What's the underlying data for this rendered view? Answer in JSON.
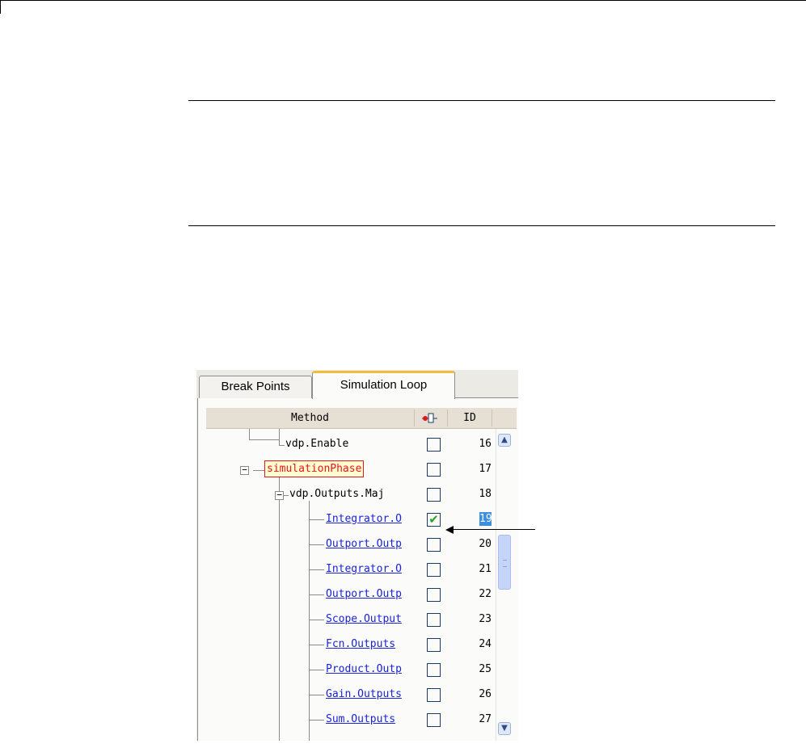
{
  "tabs": [
    {
      "label": "Break Points",
      "active": false
    },
    {
      "label": "Simulation Loop",
      "active": true
    }
  ],
  "table": {
    "method_header": "Method",
    "breakpoint_header_icon": "breakpoint-icon",
    "id_header": "ID"
  },
  "rows": [
    {
      "text": "vdp.Enable",
      "style": "plain",
      "id": "16",
      "checked": false
    },
    {
      "text": "simulationPhase",
      "style": "phase",
      "id": "17",
      "checked": false
    },
    {
      "text": "vdp.Outputs.Maj",
      "style": "plain",
      "id": "18",
      "checked": false
    },
    {
      "text": "Integrator.O",
      "style": "link",
      "id": "19",
      "checked": true,
      "selected": true
    },
    {
      "text": "Outport.Outp",
      "style": "link",
      "id": "20",
      "checked": false
    },
    {
      "text": "Integrator.O",
      "style": "link",
      "id": "21",
      "checked": false
    },
    {
      "text": "Outport.Outp",
      "style": "link",
      "id": "22",
      "checked": false
    },
    {
      "text": "Scope.Output",
      "style": "link",
      "id": "23",
      "checked": false
    },
    {
      "text": "Fcn.Outputs",
      "style": "link",
      "id": "24",
      "checked": false
    },
    {
      "text": "Product.Outp",
      "style": "link",
      "id": "25",
      "checked": false
    },
    {
      "text": "Gain.Outputs",
      "style": "link",
      "id": "26",
      "checked": false
    },
    {
      "text": "Sum.Outputs",
      "style": "link",
      "id": "27",
      "checked": false
    }
  ],
  "checkmark_glyph": "✔",
  "expander_glyph": "−",
  "scroll_up_glyph": "▲",
  "scroll_down_glyph": "▼",
  "colors": {
    "tab_accent": "#f4ba3c",
    "link": "#1a23d8",
    "phase_text": "#e8141e",
    "check": "#27a327",
    "selection": "#3b8fde"
  }
}
